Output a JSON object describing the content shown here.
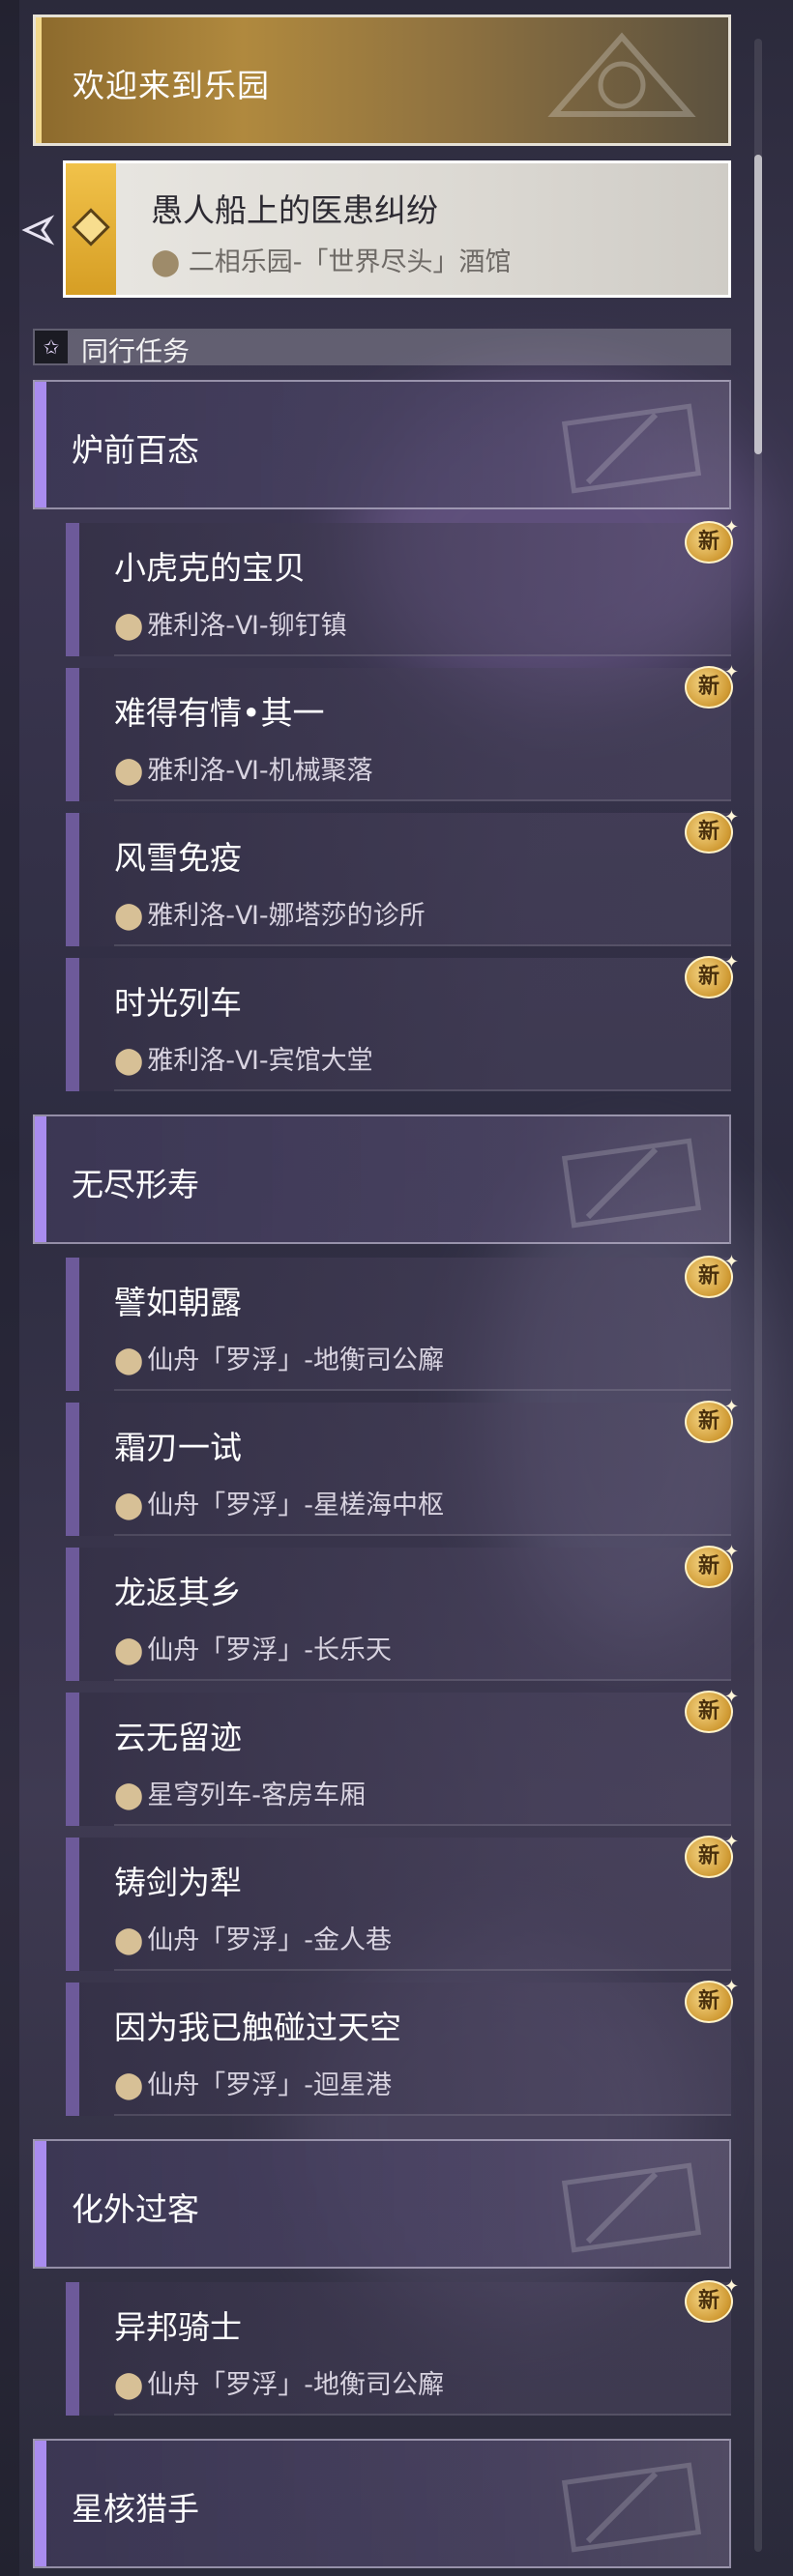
{
  "header": {
    "title": "欢迎来到乐园"
  },
  "active_quest": {
    "title": "愚人船上的医患纠纷",
    "location": "二相乐园-「世界尽头」酒馆"
  },
  "section": {
    "label": "同行任务"
  },
  "icons": {
    "pin": "location-pin-icon",
    "star": "star-icon",
    "new": "new-badge-icon",
    "pointer": "tracking-pointer-icon"
  },
  "new_label": "新",
  "categories": [
    {
      "title": "炉前百态",
      "quests": [
        {
          "title": "小虎克的宝贝",
          "location": "雅利洛-Ⅵ-铆钉镇"
        },
        {
          "title": "难得有情•其一",
          "location": "雅利洛-Ⅵ-机械聚落"
        },
        {
          "title": "风雪免疫",
          "location": "雅利洛-Ⅵ-娜塔莎的诊所"
        },
        {
          "title": "时光列车",
          "location": "雅利洛-Ⅵ-宾馆大堂"
        }
      ]
    },
    {
      "title": "无尽形寿",
      "quests": [
        {
          "title": "譬如朝露",
          "location": "仙舟「罗浮」-地衡司公廨"
        },
        {
          "title": "霜刃一试",
          "location": "仙舟「罗浮」-星槎海中枢"
        },
        {
          "title": "龙返其乡",
          "location": "仙舟「罗浮」-长乐天"
        },
        {
          "title": "云无留迹",
          "location": "星穹列车-客房车厢"
        },
        {
          "title": "铸剑为犁",
          "location": "仙舟「罗浮」-金人巷"
        },
        {
          "title": "因为我已触碰过天空",
          "location": "仙舟「罗浮」-迴星港"
        }
      ]
    },
    {
      "title": "化外过客",
      "quests": [
        {
          "title": "异邦骑士",
          "location": "仙舟「罗浮」-地衡司公廨"
        }
      ]
    },
    {
      "title": "星核猎手",
      "quests": []
    }
  ]
}
